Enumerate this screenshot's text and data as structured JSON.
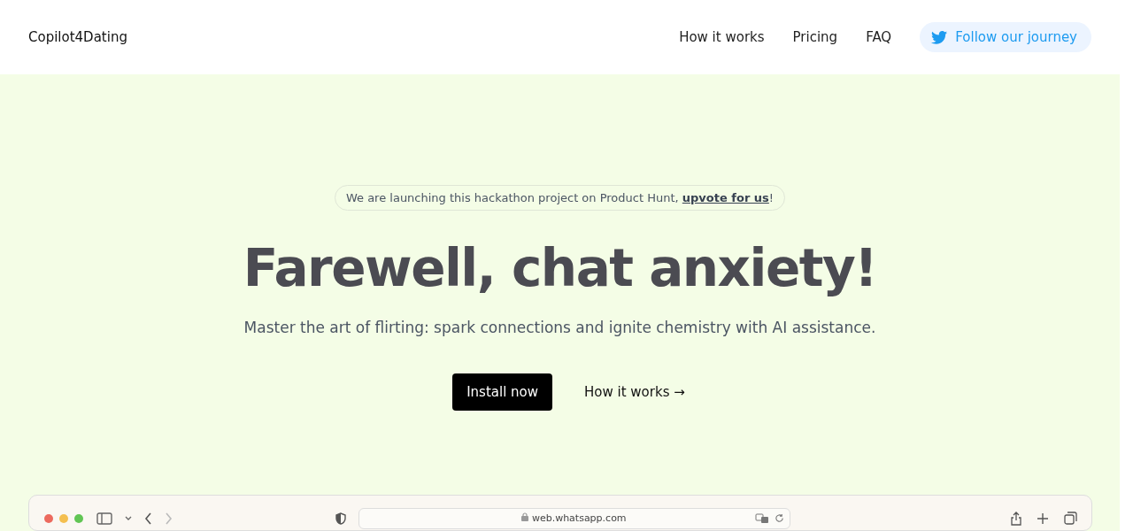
{
  "header": {
    "logo": "Copilot4Dating",
    "nav": [
      "How it works",
      "Pricing",
      "FAQ"
    ],
    "follow_button": "Follow our journey"
  },
  "hero": {
    "announcement": {
      "text_before": "We are launching this hackathon project on Product Hunt, ",
      "link": "upvote for us",
      "text_after": "!"
    },
    "title": "Farewell, chat anxiety!",
    "subtitle": "Master the art of flirting: spark connections and ignite chemistry with AI assistance.",
    "primary_button": "Install now",
    "secondary_link": "How it works →"
  },
  "browser": {
    "address": "web.whatsapp.com"
  }
}
